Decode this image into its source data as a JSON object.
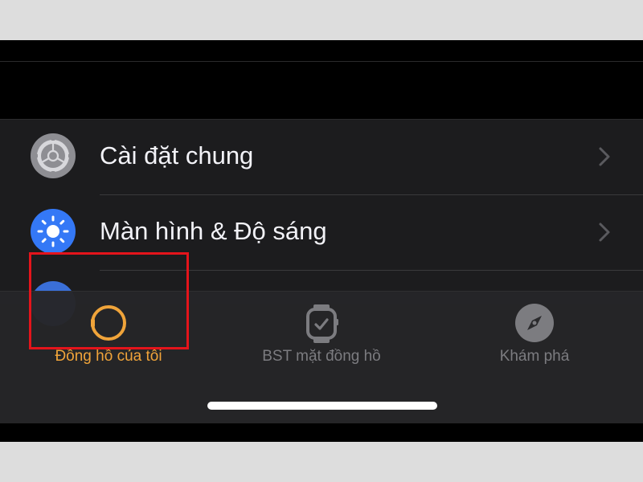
{
  "settings": {
    "items": [
      {
        "label": "Cài đặt chung",
        "icon": "gear-icon",
        "icon_color": "#8e8e93"
      },
      {
        "label": "Màn hình & Độ sáng",
        "icon": "sun-icon",
        "icon_color": "#3478f6"
      }
    ]
  },
  "tabbar": {
    "tabs": [
      {
        "label": "Đồng hồ của tôi",
        "icon": "watch-icon",
        "active": true,
        "color": "#f0a43a"
      },
      {
        "label": "BST mặt đồng hồ",
        "icon": "watch-face-icon",
        "active": false,
        "color": "#7c7c80"
      },
      {
        "label": "Khám phá",
        "icon": "compass-icon",
        "active": false,
        "color": "#7c7c80"
      }
    ]
  },
  "annotation": {
    "color": "#e4141b"
  }
}
